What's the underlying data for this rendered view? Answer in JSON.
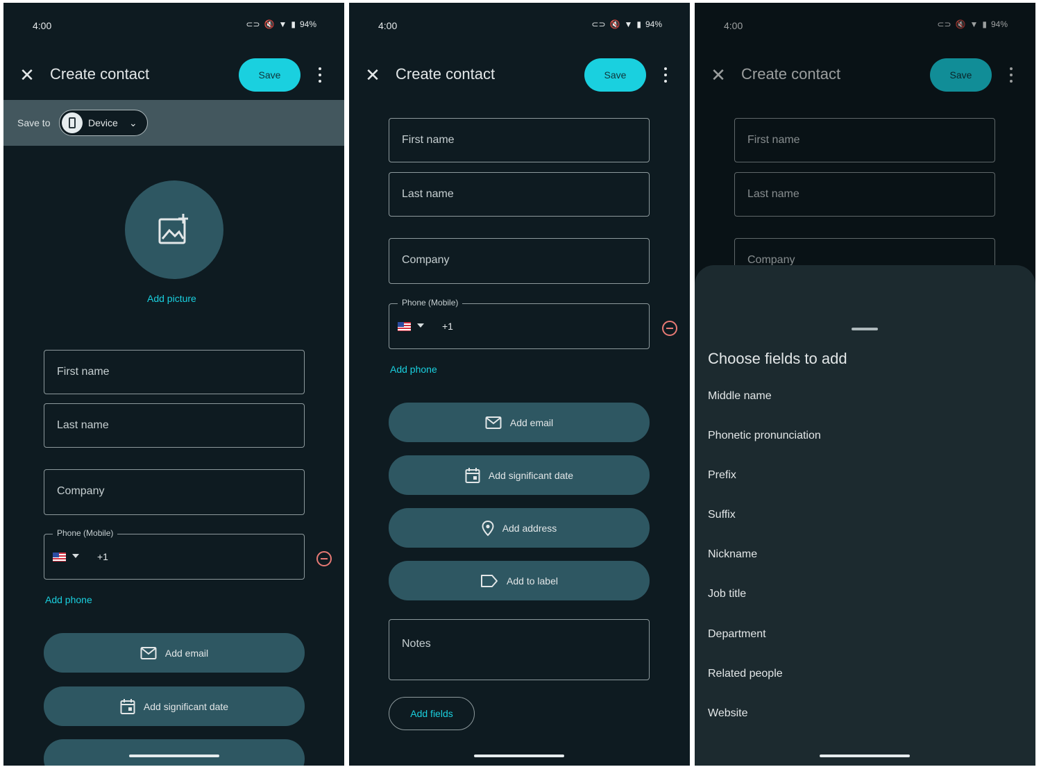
{
  "status": {
    "time": "4:00",
    "battery": "94%"
  },
  "appbar": {
    "title": "Create contact",
    "save_label": "Save"
  },
  "save_to": {
    "label": "Save to",
    "device": "Device"
  },
  "avatar": {
    "add_picture": "Add picture"
  },
  "fields": {
    "first_name": "First name",
    "last_name": "Last name",
    "company": "Company",
    "phone_label": "Phone (Mobile)",
    "country_code": "+1",
    "notes": "Notes"
  },
  "links": {
    "add_phone": "Add phone",
    "add_fields": "Add fields"
  },
  "pills": {
    "add_email": "Add email",
    "add_significant_date": "Add significant date",
    "add_address": "Add address",
    "add_to_label": "Add to label"
  },
  "sheet": {
    "title": "Choose fields to add",
    "options": [
      "Middle name",
      "Phonetic pronunciation",
      "Prefix",
      "Suffix",
      "Nickname",
      "Job title",
      "Department",
      "Related people",
      "Website"
    ]
  },
  "icons": {
    "close": "close-icon",
    "more": "more-vert-icon",
    "device": "phone-icon",
    "add_photo": "add-photo-icon",
    "email": "mail-icon",
    "date": "calendar-icon",
    "address": "location-pin-icon",
    "label": "label-icon",
    "remove": "remove-circle-icon"
  },
  "colors": {
    "background": "#0e1b21",
    "accent": "#1ad0df",
    "pill": "#2e5762",
    "remove": "#e87a75",
    "sheet": "#1c2a2f"
  }
}
